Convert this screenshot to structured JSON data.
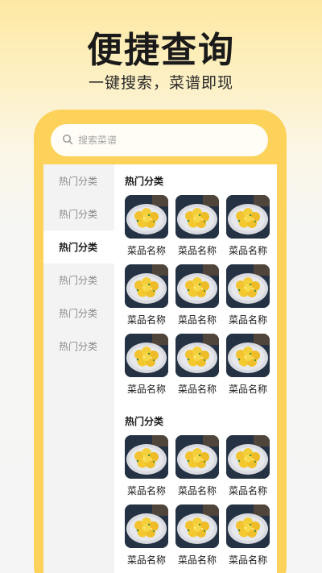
{
  "header": {
    "title": "便捷查询",
    "subtitle": "一键搜索，菜谱即现"
  },
  "search": {
    "placeholder": "搜索菜谱"
  },
  "sidebar": {
    "items": [
      {
        "label": "热门分类",
        "active": false
      },
      {
        "label": "热门分类",
        "active": false
      },
      {
        "label": "热门分类",
        "active": true
      },
      {
        "label": "热门分类",
        "active": false
      },
      {
        "label": "热门分类",
        "active": false
      },
      {
        "label": "热门分类",
        "active": false
      }
    ]
  },
  "sections": [
    {
      "title": "热门分类",
      "items": [
        "菜品名称",
        "菜品名称",
        "菜品名称",
        "菜品名称",
        "菜品名称",
        "菜品名称",
        "菜品名称",
        "菜品名称",
        "菜品名称"
      ]
    },
    {
      "title": "热门分类",
      "items": [
        "菜品名称",
        "菜品名称",
        "菜品名称",
        "菜品名称",
        "菜品名称",
        "菜品名称"
      ]
    }
  ],
  "colors": {
    "accent": "#fcd25a",
    "frame_bg": "#fffdf5",
    "sidebar_bg": "#f3f3f3"
  },
  "icons": {
    "search": "search-icon",
    "dish": "dish-photo"
  }
}
